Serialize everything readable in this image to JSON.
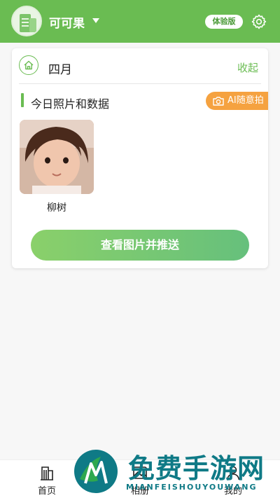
{
  "header": {
    "username": "可可果",
    "trial_badge": "体验版"
  },
  "card": {
    "month": "四月",
    "collapse_label": "收起",
    "section_title": "今日照片和数据",
    "ai_button_label": "AI随意拍",
    "photo_name": "柳树",
    "view_button_label": "查看图片并推送"
  },
  "bottom_nav": {
    "items": [
      {
        "label": "首页"
      },
      {
        "label": "相册"
      },
      {
        "label": "我的"
      }
    ]
  },
  "watermark": {
    "title": "免费手游网",
    "subtitle": "MIANFEISHOUYOUWANG"
  },
  "colors": {
    "brand_green": "#6abc52",
    "accent_orange": "#f5a240",
    "watermark_teal": "#0f7a86"
  },
  "icons": [
    "avatar-building-icon",
    "chevron-down-icon",
    "gear-icon",
    "home-icon",
    "camera-icon",
    "building-icon",
    "album-icon",
    "person-icon"
  ]
}
